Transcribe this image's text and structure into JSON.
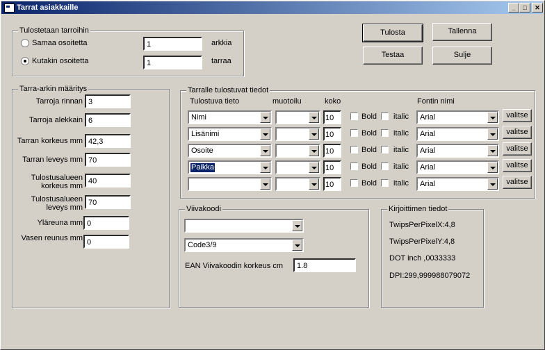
{
  "window": {
    "title": "Tarrat asiakkaille",
    "min": "_",
    "max": "□",
    "close": "✕"
  },
  "buttons": {
    "tulosta": "Tulosta",
    "tallenna": "Tallenna",
    "testaa": "Testaa",
    "sulje": "Sulje"
  },
  "print_group": {
    "legend": "Tulostetaan tarroihin",
    "option1_label": "Samaa osoitetta",
    "option1_value": "1",
    "option1_unit": "arkkia",
    "option2_label": "Kutakin osoitetta",
    "option2_value": "1",
    "option2_unit": "tarraa",
    "selected": "option2"
  },
  "sheet_group": {
    "legend": "Tarra-arkin määritys",
    "fields": [
      {
        "label": "Tarroja rinnan",
        "value": "3"
      },
      {
        "label": "Tarroja alekkain",
        "value": "6"
      },
      {
        "label": "Tarran korkeus mm",
        "value": "42,3"
      },
      {
        "label": "Tarran leveys mm",
        "value": "70"
      },
      {
        "label": "Tulostusalueen korkeus mm",
        "value": "40"
      },
      {
        "label": "Tulostusalueen leveys mm",
        "value": "70"
      },
      {
        "label": "Yläreuna mm",
        "value": "0"
      },
      {
        "label": "Vasen reunus mm",
        "value": "0"
      }
    ]
  },
  "fields_group": {
    "legend": "Tarralle tulostuvat tiedot",
    "headers": {
      "field": "Tulostuva tieto",
      "format": "muotoilu",
      "size": "koko",
      "font": "Fontin nimi"
    },
    "rows": [
      {
        "field": "Nimi",
        "format": "",
        "size": "10",
        "bold": "Bold",
        "italic": "italic",
        "font": "Arial",
        "button": "valitse"
      },
      {
        "field": "Lisänimi",
        "format": "",
        "size": "10",
        "bold": "Bold",
        "italic": "italic",
        "font": "Arial",
        "button": "valitse"
      },
      {
        "field": "Osoite",
        "format": "",
        "size": "10",
        "bold": "Bold",
        "italic": "italic",
        "font": "Arial",
        "button": "valitse"
      },
      {
        "field": "Paikka",
        "format": "",
        "size": "10",
        "bold": "Bold",
        "italic": "italic",
        "font": "Arial",
        "button": "valitse"
      },
      {
        "field": "",
        "format": "",
        "size": "10",
        "bold": "Bold",
        "italic": "italic",
        "font": "Arial",
        "button": "valitse"
      }
    ]
  },
  "barcode_group": {
    "legend": "Viivakoodi",
    "combo1": "",
    "combo2": "Code3/9",
    "height_label": "EAN Viivakoodin korkeus cm",
    "height_value": "1.8"
  },
  "printer_group": {
    "legend": "Kirjoittimen tiedot",
    "lines": [
      "TwipsPerPixelX:4,8",
      "TwipsPerPixelY:4,8",
      "DOT inch ,0033333",
      "DPI:299,999988079072"
    ]
  }
}
